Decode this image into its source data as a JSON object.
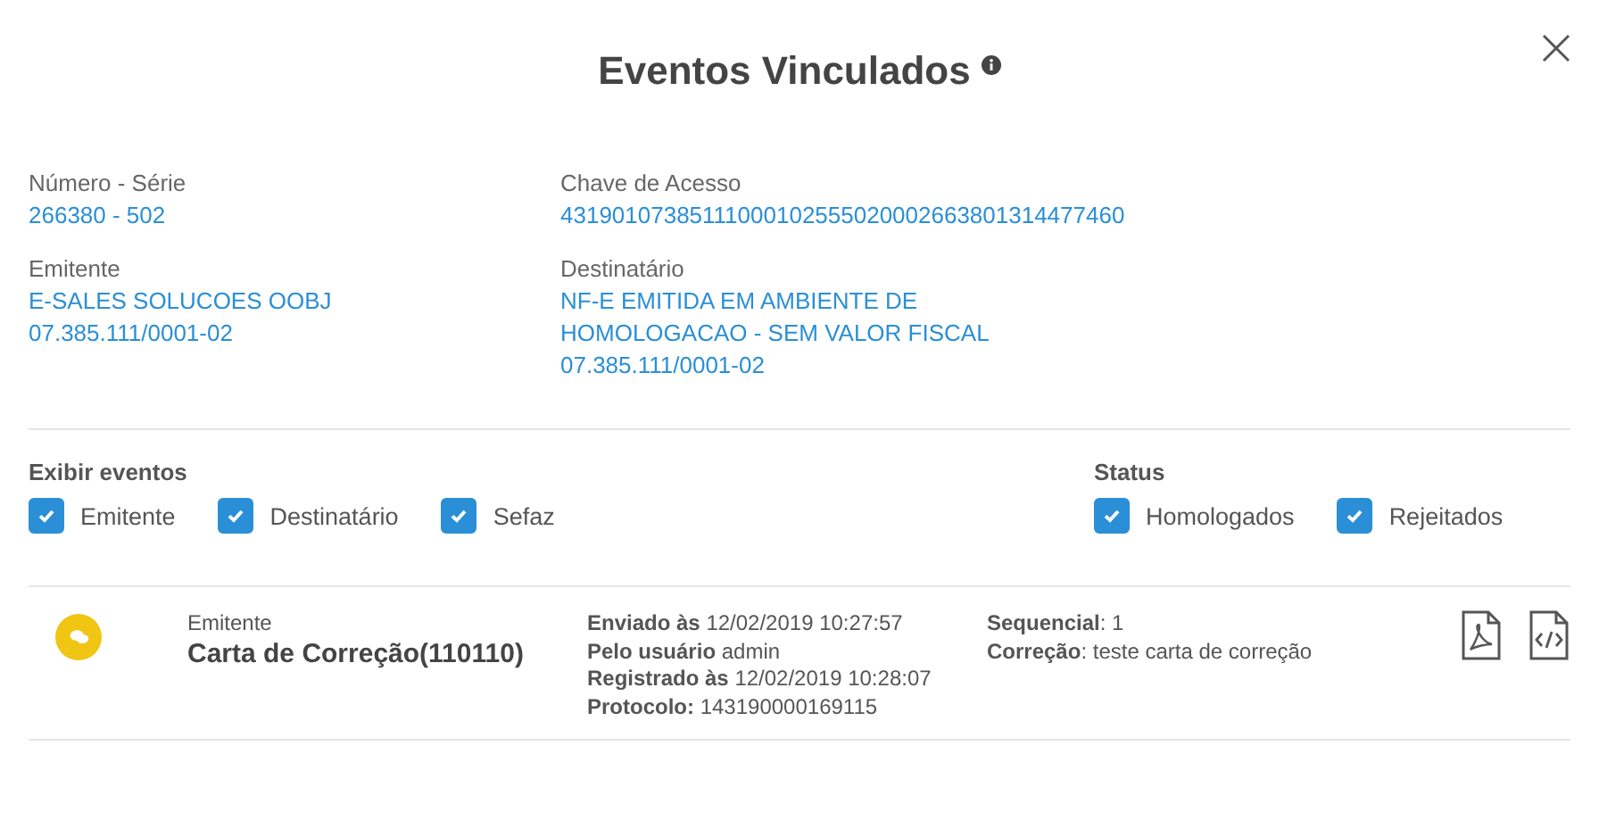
{
  "title": "Eventos Vinculados",
  "info": [
    {
      "label": "Número - Série",
      "lines": [
        "266380 - 502"
      ]
    },
    {
      "label": "Chave de Acesso",
      "lines": [
        "43190107385111000102555020002663801314477460"
      ]
    },
    {
      "label": "Emitente",
      "lines": [
        "E-SALES SOLUCOES OOBJ",
        "07.385.111/0001-02"
      ]
    },
    {
      "label": "Destinatário",
      "lines": [
        "NF-E EMITIDA EM AMBIENTE DE",
        "HOMOLOGACAO - SEM VALOR FISCAL",
        "07.385.111/0001-02"
      ]
    }
  ],
  "filters": [
    {
      "title": "Exibir eventos",
      "options": [
        {
          "label": "Emitente",
          "checked": true
        },
        {
          "label": "Destinatário",
          "checked": true
        },
        {
          "label": "Sefaz",
          "checked": true
        }
      ]
    },
    {
      "title": "Status",
      "options": [
        {
          "label": "Homologados",
          "checked": true
        },
        {
          "label": "Rejeitados",
          "checked": true
        }
      ]
    }
  ],
  "events": [
    {
      "origin": "Emitente",
      "name": "Carta de Correção(110110)",
      "details": [
        "**Enviado às** 12/02/2019 10:27:57",
        "**Pelo usuário** admin",
        "**Registrado às** 12/02/2019 10:28:07",
        "**Protocolo:** 143190000169115"
      ],
      "extra": [
        "**Sequencial**: 1",
        "**Correção**: teste carta de correção"
      ]
    }
  ]
}
